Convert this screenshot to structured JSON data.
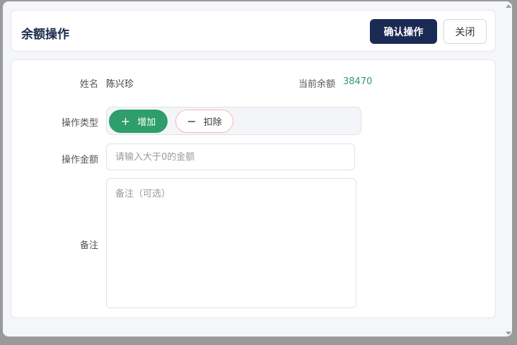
{
  "header": {
    "title": "余额操作",
    "confirm_label": "确认操作",
    "close_label": "关闭"
  },
  "form": {
    "name_label": "姓名",
    "name_value": "陈兴珍",
    "balance_label": "当前余额",
    "balance_value": "38470",
    "op_type_label": "操作类型",
    "op_add_label": "增加",
    "op_sub_label": "扣除",
    "amount_label": "操作金额",
    "amount_placeholder": "请输入大于0的金额",
    "note_label": "备注",
    "note_placeholder": "备注（可选）"
  },
  "icons": {
    "add": "plus-icon",
    "sub": "minus-icon"
  },
  "colors": {
    "primary": "#1b2a55",
    "success": "#2e9e6a",
    "danger_border": "#f0b9bf"
  }
}
